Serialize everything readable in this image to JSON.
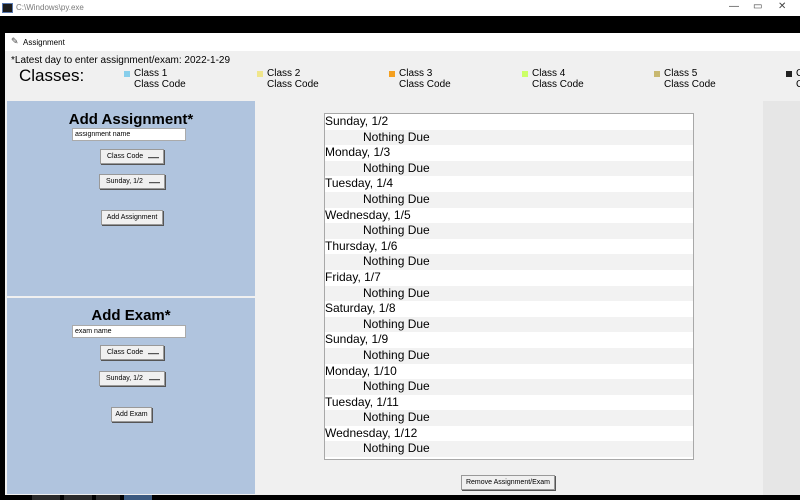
{
  "console": {
    "title": "C:\\Windows\\py.exe",
    "minimize": "—",
    "maximize": "▭",
    "close": "✕"
  },
  "app": {
    "title": "Assignment",
    "latest_day": "*Latest day to enter assignment/exam: 2022-1-29",
    "classes_label": "Classes:",
    "classes": [
      {
        "name": "Class 1",
        "code": "Class Code",
        "color": "#87ceeb"
      },
      {
        "name": "Class 2",
        "code": "Class Code",
        "color": "#f0e68c"
      },
      {
        "name": "Class 3",
        "code": "Class Code",
        "color": "#f4a020"
      },
      {
        "name": "Class 4",
        "code": "Class Code",
        "color": "#ccff66"
      },
      {
        "name": "Class 5",
        "code": "Class Code",
        "color": "#c8b870"
      },
      {
        "name": "C",
        "code": "C",
        "color": "#222222"
      }
    ],
    "panel_color": "#b0c4de"
  },
  "add_assignment": {
    "heading": "Add Assignment*",
    "name_value": "assignment name",
    "class_code": "Class Code",
    "date": "Sunday, 1/2",
    "button": "Add Assignment"
  },
  "add_exam": {
    "heading": "Add Exam*",
    "name_value": "exam name",
    "class_code": "Class Code",
    "date": "Sunday, 1/2",
    "button": "Add Exam"
  },
  "schedule": {
    "days": [
      {
        "day": "Sunday, 1/2",
        "status": "Nothing Due"
      },
      {
        "day": "Monday, 1/3",
        "status": "Nothing Due"
      },
      {
        "day": "Tuesday, 1/4",
        "status": "Nothing Due"
      },
      {
        "day": "Wednesday, 1/5",
        "status": "Nothing Due"
      },
      {
        "day": "Thursday, 1/6",
        "status": "Nothing Due"
      },
      {
        "day": "Friday, 1/7",
        "status": "Nothing Due"
      },
      {
        "day": "Saturday, 1/8",
        "status": "Nothing Due"
      },
      {
        "day": "Sunday, 1/9",
        "status": "Nothing Due"
      },
      {
        "day": "Monday, 1/10",
        "status": "Nothing Due"
      },
      {
        "day": "Tuesday, 1/11",
        "status": "Nothing Due"
      },
      {
        "day": "Wednesday, 1/12",
        "status": "Nothing Due"
      }
    ],
    "remove_button": "Remove Assignment/Exam"
  }
}
